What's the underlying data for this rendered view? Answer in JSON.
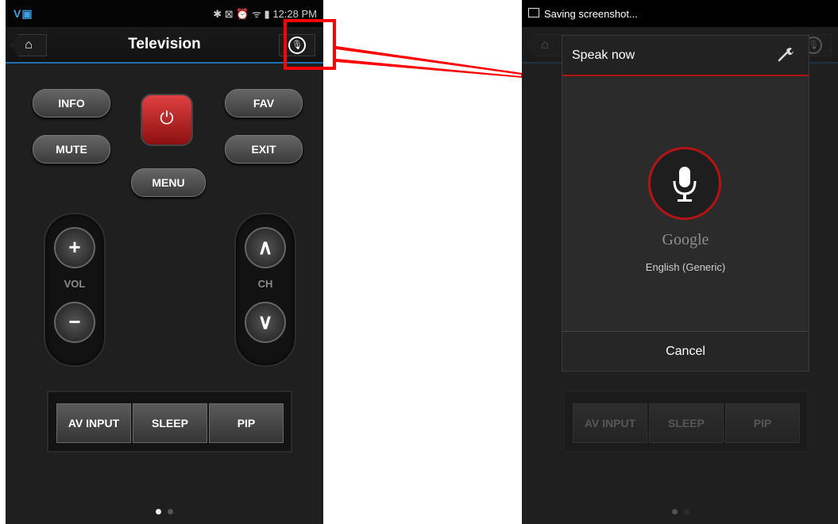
{
  "left_screen": {
    "status_bar": {
      "left_icons": "V▣",
      "right_icons": "✱ ⊠ ⏰ ᯤ ▮",
      "time": "12:28 PM"
    },
    "app_bar": {
      "title": "Television"
    },
    "buttons": {
      "info": "INFO",
      "fav": "FAV",
      "mute": "MUTE",
      "exit": "EXIT",
      "menu": "MENU",
      "vol_label": "VOL",
      "ch_label": "CH",
      "vol_up": "+",
      "vol_down": "−",
      "ch_up": "∧",
      "ch_down": "∨"
    },
    "bottom_buttons": [
      "AV INPUT",
      "SLEEP",
      "PIP"
    ],
    "power_glyph": "⏻"
  },
  "right_screen": {
    "notification": "Saving screenshot...",
    "dialog": {
      "title": "Speak now",
      "brand": "Google",
      "language": "English (Generic)",
      "cancel": "Cancel"
    },
    "bottom_buttons": [
      "AV INPUT",
      "SLEEP",
      "PIP"
    ]
  },
  "colors": {
    "highlight": "#ff0000",
    "accent_blue": "#1e6fb2",
    "speak_red": "#b51414"
  }
}
